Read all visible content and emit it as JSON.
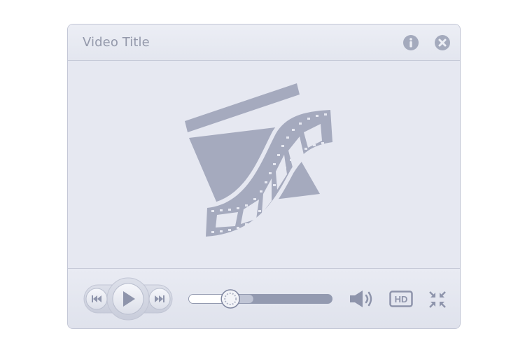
{
  "window": {
    "title": "Video Title"
  },
  "titlebar": {
    "buttons": [
      {
        "icon": "info-icon"
      },
      {
        "icon": "close-icon"
      }
    ]
  },
  "screen": {
    "placeholder_icon": "clapperboard-film-icon"
  },
  "controls": {
    "buttons": [
      {
        "icon": "rewind-icon"
      },
      {
        "icon": "play-icon"
      },
      {
        "icon": "fast-forward-icon"
      },
      {
        "icon": "volume-icon"
      },
      {
        "icon": "hd-icon",
        "label": "HD"
      },
      {
        "icon": "exit-fullscreen-icon"
      }
    ],
    "seek": {
      "played_fraction": 0.29,
      "buffered_fraction": 0.45
    }
  },
  "colors": {
    "accent": "#8e94ab",
    "background": "#e7e9f2",
    "played": "#ffffff",
    "track": "#939ab0"
  }
}
